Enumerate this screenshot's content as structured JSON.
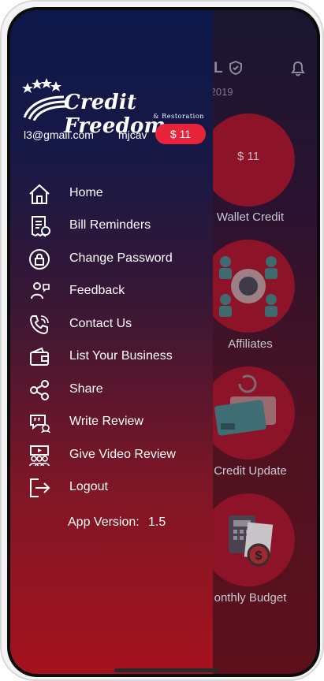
{
  "header": {
    "title_fragment": "L",
    "date_fragment": "/2019"
  },
  "dashboard": {
    "cards": [
      {
        "label": "Wallet Credit",
        "value": "$ 11",
        "icon": "dollar-circle"
      },
      {
        "label": "Affiliates",
        "icon": "people-network-icon"
      },
      {
        "label": "Credit Update",
        "icon": "credit-card-icon"
      },
      {
        "label": "onthly Budget",
        "icon": "budget-calculator-icon"
      }
    ]
  },
  "drawer": {
    "logo": {
      "text": "Credit Freedom",
      "subtext": "& Restoration"
    },
    "user": {
      "email": "l3@gmail.com",
      "name": "mjcav",
      "balance": "$ 11"
    },
    "menu": [
      {
        "label": "Home",
        "icon": "home-icon"
      },
      {
        "label": "Bill Reminders",
        "icon": "bill-reminder-icon"
      },
      {
        "label": "Change Password",
        "icon": "lock-icon"
      },
      {
        "label": "Feedback",
        "icon": "feedback-icon"
      },
      {
        "label": "Contact Us",
        "icon": "phone-icon"
      },
      {
        "label": "List Your Business",
        "icon": "wallet-icon"
      },
      {
        "label": "Share",
        "icon": "share-icon"
      },
      {
        "label": "Write Review",
        "icon": "review-icon"
      },
      {
        "label": "Give Video Review",
        "icon": "video-review-icon"
      },
      {
        "label": "Logout",
        "icon": "logout-icon"
      }
    ],
    "version_label": "App Version:",
    "version_value": "1.5"
  },
  "colors": {
    "accent": "#e8243a",
    "drawer_top": "#0d1749",
    "drawer_bottom": "#a5121d",
    "card_circle": "#8c1328"
  }
}
